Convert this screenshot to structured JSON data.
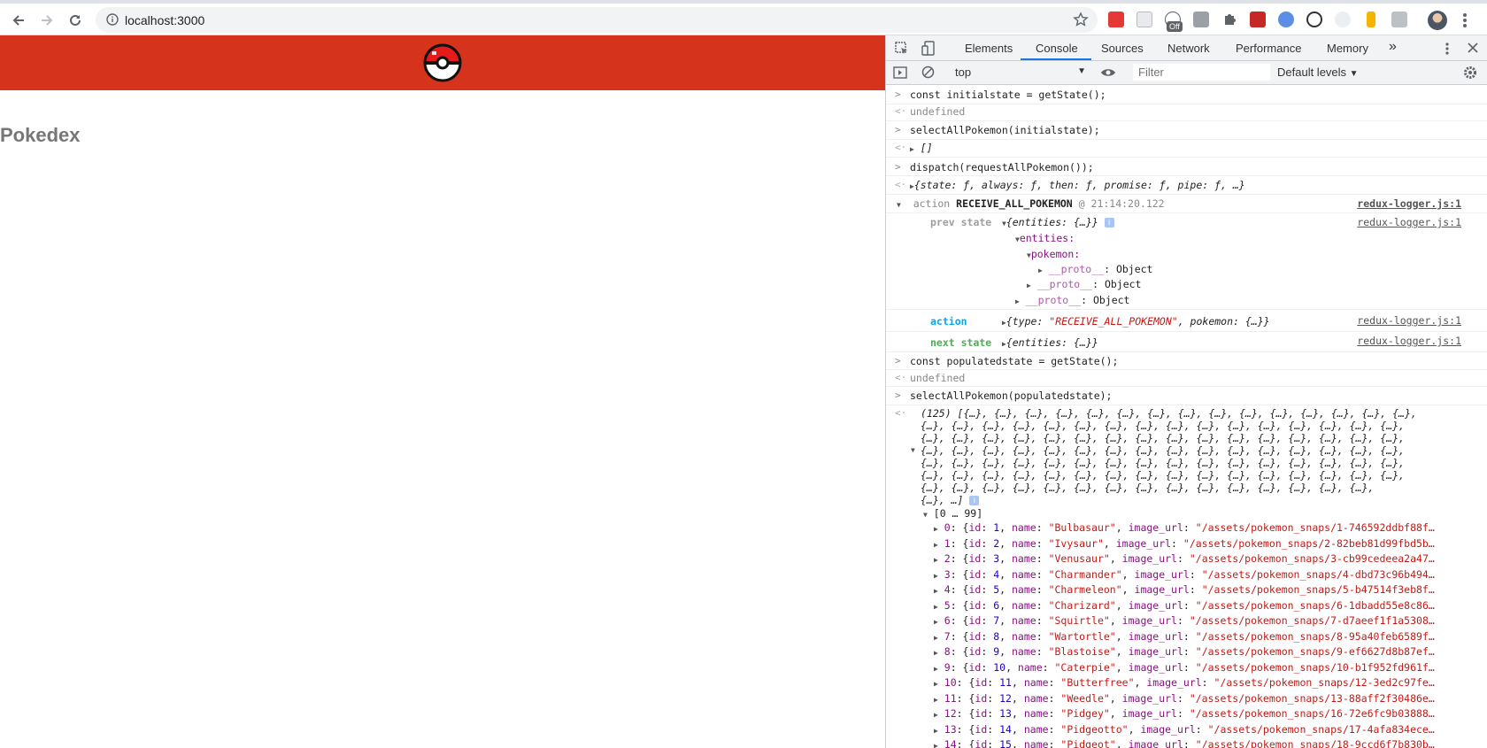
{
  "browser": {
    "url": "localhost:3000",
    "ext_badge": "Off"
  },
  "page": {
    "title": "Pokedex",
    "header_color": "#d6331c"
  },
  "devtools": {
    "tabs": [
      "Elements",
      "Console",
      "Sources",
      "Network",
      "Performance",
      "Memory"
    ],
    "active_tab": "Console",
    "more_tabs": "»",
    "context": "top",
    "filter_placeholder": "Filter",
    "levels": "Default levels",
    "console": {
      "l1": "const initialstate = getState();",
      "l2": "undefined",
      "l3": "selectAllPokemon(initialstate);",
      "l4": "[]",
      "l5": "dispatch(requestAllPokemon());",
      "l6": "{state: ƒ, always: ƒ, then: ƒ, promise: ƒ, pipe: ƒ, …}",
      "g_action_word": "action",
      "g_action_name": "RECEIVE_ALL_POKEMON",
      "g_action_time": "@ 21:14:20.122",
      "logger_link": "redux-logger.js:1",
      "prev_state_label": "prev state",
      "prev_state_val": "{entities: {…}}",
      "entities": "entities:",
      "pokemon": "pokemon:",
      "proto1": "__proto__",
      "proto2": "__proto__",
      "proto3": "__proto__",
      "object": "Object",
      "action_label": "action",
      "action_val_pre": "{type: ",
      "action_val_str": "\"RECEIVE_ALL_POKEMON\"",
      "action_val_post": ", pokemon: {…}}",
      "next_state_label": "next state",
      "next_state_val": "{entities: {…}}",
      "l7": "const populatedstate = getState();",
      "l8": "undefined",
      "l9": "selectAllPokemon(populatedstate);",
      "arr_rows": [
        "(125) [{…}, {…}, {…}, {…}, {…}, {…}, {…}, {…}, {…}, {…}, {…}, {…}, {…}, {…}, {…},",
        "{…}, {…}, {…}, {…}, {…}, {…}, {…}, {…}, {…}, {…}, {…}, {…}, {…}, {…}, {…}, {…},",
        "{…}, {…}, {…}, {…}, {…}, {…}, {…}, {…}, {…}, {…}, {…}, {…}, {…}, {…}, {…}, {…},",
        "{…}, {…}, {…}, {…}, {…}, {…}, {…}, {…}, {…}, {…}, {…}, {…}, {…}, {…}, {…}, {…},",
        "{…}, {…}, {…}, {…}, {…}, {…}, {…}, {…}, {…}, {…}, {…}, {…}, {…}, {…}, {…}, {…},",
        "{…}, {…}, {…}, {…}, {…}, {…}, {…}, {…}, {…}, {…}, {…}, {…}, {…}, {…}, {…}, {…},",
        "{…}, {…}, {…}, {…}, {…}, {…}, {…}, {…}, {…}, {…}, {…}, {…}, {…}, {…}, {…},",
        "{…}, …]"
      ],
      "range": "[0 … 99]",
      "pokemon_list": [
        {
          "idx": "0",
          "id": "1",
          "name": "\"Bulbasaur\"",
          "url": "\"/assets/pokemon_snaps/1-746592ddbf88f…"
        },
        {
          "idx": "1",
          "id": "2",
          "name": "\"Ivysaur\"",
          "url": "\"/assets/pokemon_snaps/2-82beb81d99fbd5b…"
        },
        {
          "idx": "2",
          "id": "3",
          "name": "\"Venusaur\"",
          "url": "\"/assets/pokemon_snaps/3-cb99cedeea2a47…"
        },
        {
          "idx": "3",
          "id": "4",
          "name": "\"Charmander\"",
          "url": "\"/assets/pokemon_snaps/4-dbd73c96b494…"
        },
        {
          "idx": "4",
          "id": "5",
          "name": "\"Charmeleon\"",
          "url": "\"/assets/pokemon_snaps/5-b47514f3eb8f…"
        },
        {
          "idx": "5",
          "id": "6",
          "name": "\"Charizard\"",
          "url": "\"/assets/pokemon_snaps/6-1dbadd55e8c86…"
        },
        {
          "idx": "6",
          "id": "7",
          "name": "\"Squirtle\"",
          "url": "\"/assets/pokemon_snaps/7-d7aeef1f1a5308…"
        },
        {
          "idx": "7",
          "id": "8",
          "name": "\"Wartortle\"",
          "url": "\"/assets/pokemon_snaps/8-95a40feb6589f…"
        },
        {
          "idx": "8",
          "id": "9",
          "name": "\"Blastoise\"",
          "url": "\"/assets/pokemon_snaps/9-ef6627d8b87ef…"
        },
        {
          "idx": "9",
          "id": "10",
          "name": "\"Caterpie\"",
          "url": "\"/assets/pokemon_snaps/10-b1f952fd961f…"
        },
        {
          "idx": "10",
          "id": "11",
          "name": "\"Butterfree\"",
          "url": "\"/assets/pokemon_snaps/12-3ed2c97fe…"
        },
        {
          "idx": "11",
          "id": "12",
          "name": "\"Weedle\"",
          "url": "\"/assets/pokemon_snaps/13-88aff2f30486e…"
        },
        {
          "idx": "12",
          "id": "13",
          "name": "\"Pidgey\"",
          "url": "\"/assets/pokemon_snaps/16-72e6fc9b03888…"
        },
        {
          "idx": "13",
          "id": "14",
          "name": "\"Pidgeotto\"",
          "url": "\"/assets/pokemon_snaps/17-4afa834ece…"
        },
        {
          "idx": "14",
          "id": "15",
          "name": "\"Pidgeot\"",
          "url": "\"/assets/pokemon_snaps/18-9ccd6f7b830b…"
        }
      ]
    }
  }
}
